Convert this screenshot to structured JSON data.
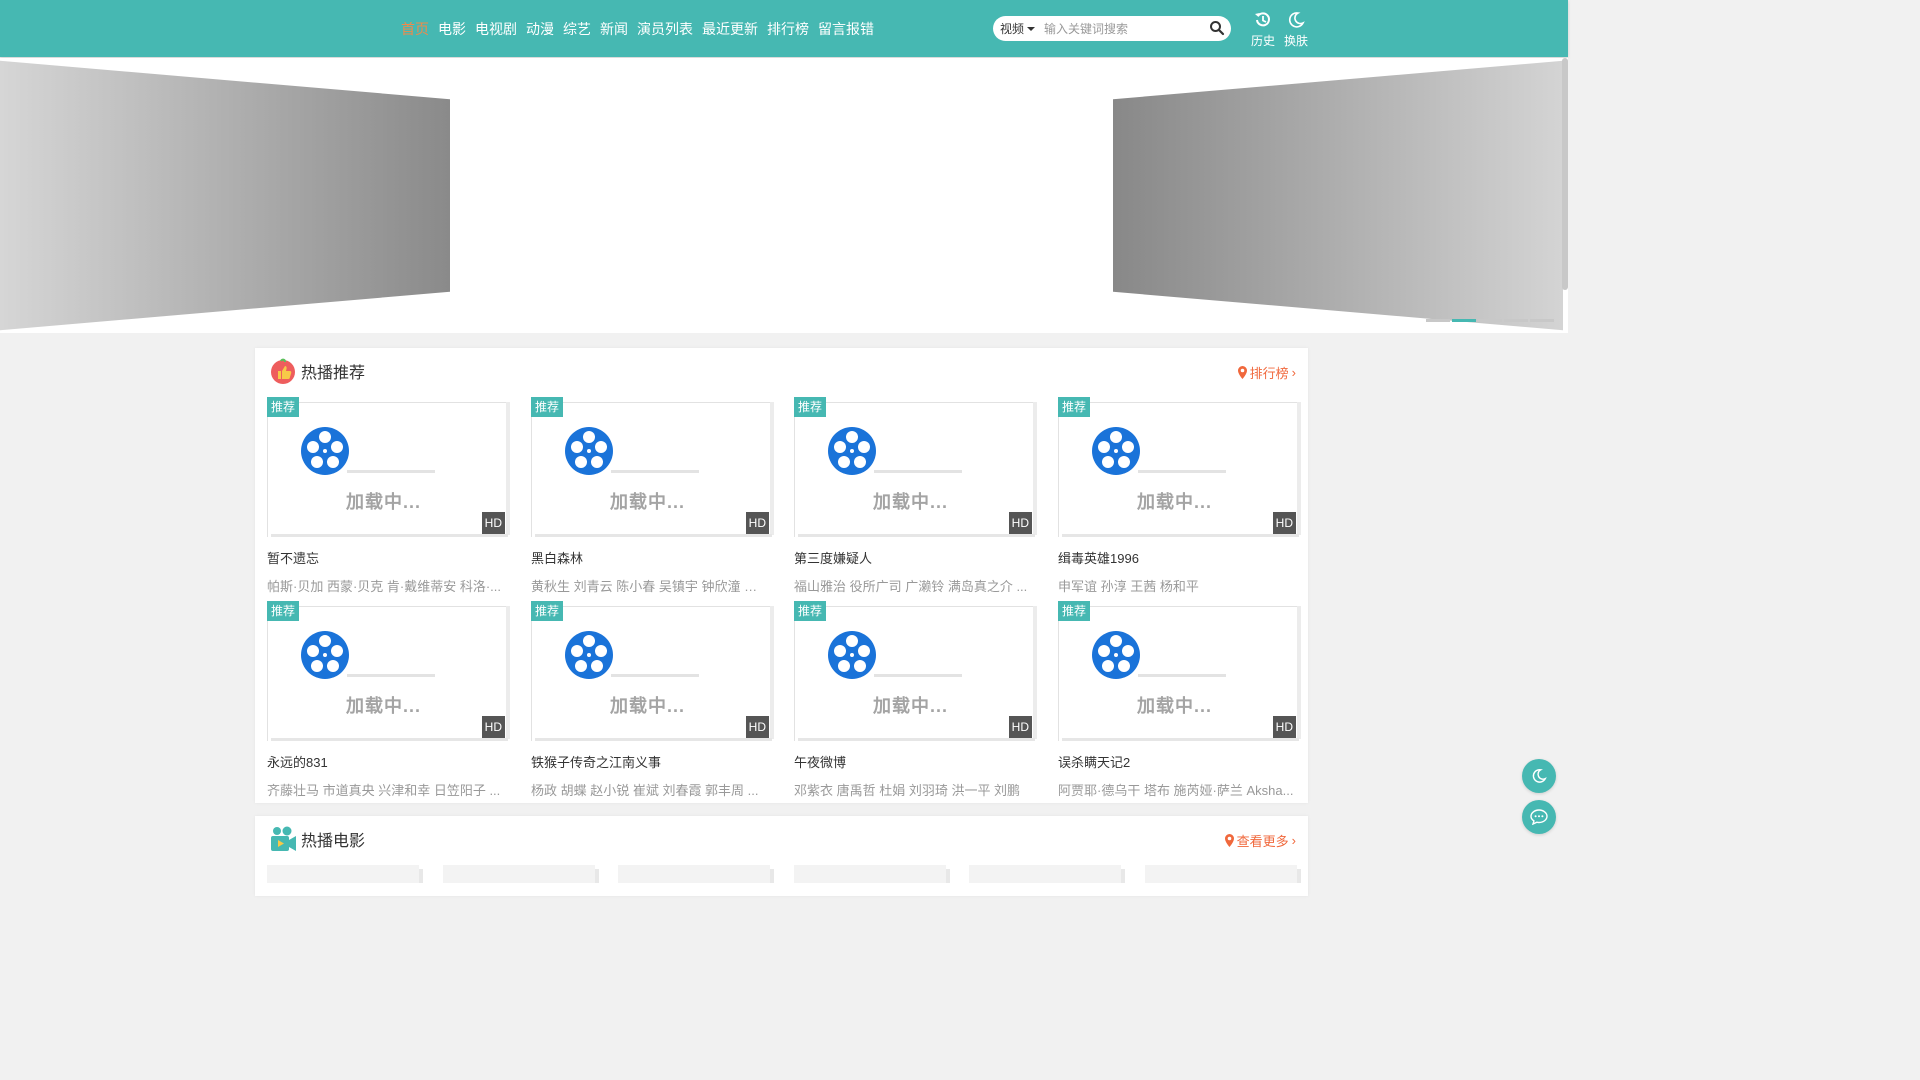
{
  "nav": {
    "items": [
      "首页",
      "电影",
      "电视剧",
      "动漫",
      "综艺",
      "新闻",
      "演员列表",
      "最近更新",
      "排行榜",
      "留言报错"
    ],
    "active_index": 0
  },
  "search": {
    "category": "视频",
    "placeholder": "输入关键词搜索"
  },
  "header_actions": {
    "history_label": "历史",
    "theme_label": "换肤"
  },
  "banner": {
    "dots_count": 5,
    "active_dot": 1
  },
  "hot_recommend": {
    "title": "热播推荐",
    "more_label": "排行榜",
    "badge": "推荐",
    "quality": "HD",
    "loading_text": "加载中...",
    "items": [
      {
        "title": "暂不遗忘",
        "cast": "帕斯·贝加 西蒙·贝克 肯·戴维蒂安 科洛·..."
      },
      {
        "title": "黑白森林",
        "cast": "黄秋生 刘青云 陈小春 吴镇宇 钟欣潼 黄..."
      },
      {
        "title": "第三度嫌疑人",
        "cast": "福山雅治 役所广司 广濑铃 满岛真之介 ..."
      },
      {
        "title": "缉毒英雄1996",
        "cast": "申军谊 孙淳 王茜 杨和平"
      },
      {
        "title": "永远的831",
        "cast": "齐藤壮马 市道真央 兴津和幸 日笠阳子 ..."
      },
      {
        "title": "铁猴子传奇之江南义事",
        "cast": "杨政 胡蝶 赵小锐 崔斌 刘春霞 郭丰周 ..."
      },
      {
        "title": "午夜微博",
        "cast": "邓紫衣 唐禹哲 杜娟 刘羽琦 洪一平 刘鹏"
      },
      {
        "title": "误杀瞒天记2",
        "cast": "阿贾耶·德乌干 塔布 施芮娅·萨兰 Aksha..."
      }
    ]
  },
  "hot_movies": {
    "title": "热播电影",
    "more_label": "查看更多"
  },
  "colors": {
    "header": "#46b8b2",
    "accent_orange": "#f0683c",
    "reel_blue": "#1a73d9"
  }
}
